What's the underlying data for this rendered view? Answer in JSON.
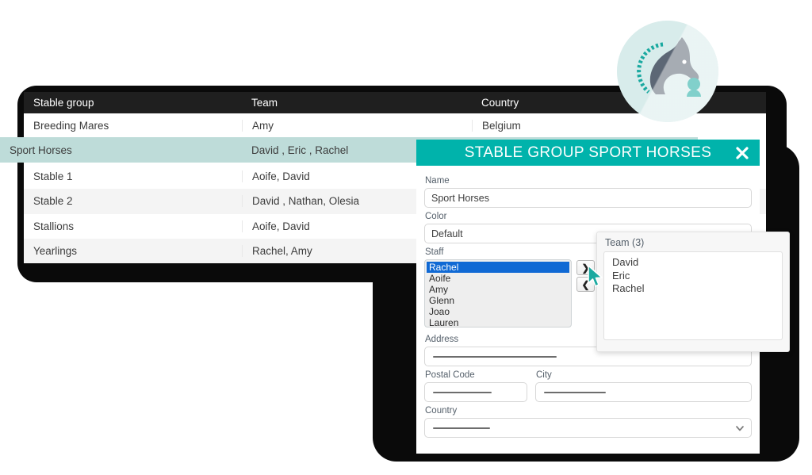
{
  "table": {
    "columns": [
      "Stable group",
      "Team",
      "Country"
    ],
    "rows": [
      {
        "group": "Breeding Mares",
        "team": "Amy",
        "country": "Belgium",
        "selected": false
      },
      {
        "group": "Sport Horses",
        "team": "David , Eric , Rachel",
        "country": "",
        "selected": true
      },
      {
        "group": "Stable 1",
        "team": "Aoife, David",
        "country": "",
        "selected": false
      },
      {
        "group": "Stable 2",
        "team": "David , Nathan, Olesia",
        "country": "",
        "selected": false
      },
      {
        "group": "Stallions",
        "team": "Aoife, David",
        "country": "",
        "selected": false
      },
      {
        "group": "Yearlings",
        "team": "Rachel, Amy",
        "country": "",
        "selected": false
      }
    ]
  },
  "logo": {
    "name": "horse-head-logo"
  },
  "dialog": {
    "title": "STABLE GROUP SPORT HORSES",
    "close_label": "✕",
    "fields": {
      "name_label": "Name",
      "name_value": "Sport Horses",
      "color_label": "Color",
      "color_value": "Default",
      "staff_label": "Staff",
      "address_label": "Address",
      "address_value": "",
      "postal_code_label": "Postal Code",
      "postal_code_value": "",
      "city_label": "City",
      "city_value": "",
      "country_label": "Country",
      "country_value": ""
    },
    "staff_options": [
      "Rachel",
      "Aoife",
      "Amy",
      "Glenn",
      "Joao",
      "Lauren"
    ],
    "staff_selected": "Rachel",
    "transfer": {
      "add_label": "❯",
      "remove_label": "❮"
    }
  },
  "team_popover": {
    "label": "Team (3)",
    "members": [
      "David",
      "Eric",
      "Rachel"
    ]
  },
  "colors": {
    "teal": "#00b3ab",
    "row_highlight": "#bedcd9",
    "header_bar": "#1f1f1f",
    "list_selection": "#1069d4",
    "logo_bg": "#d8eceb",
    "logo_horse": "#5c6775",
    "cursor": "#1aa9a0"
  }
}
